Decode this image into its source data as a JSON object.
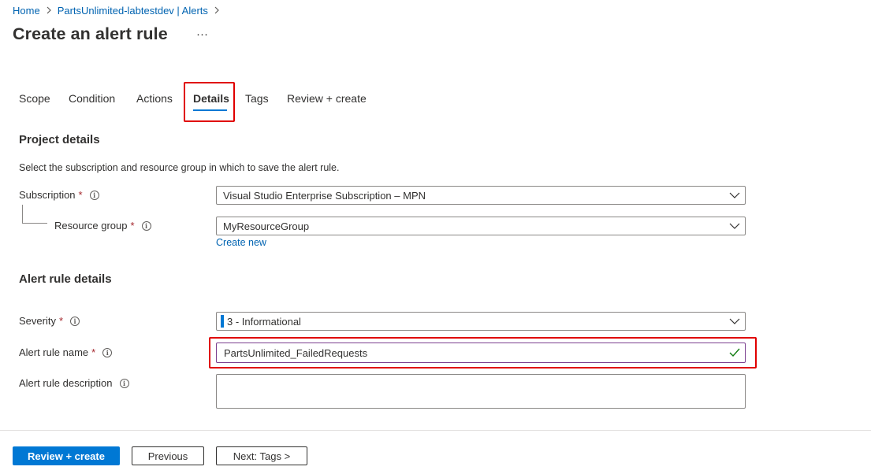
{
  "breadcrumb": {
    "items": [
      "Home",
      "PartsUnlimited-labtestdev | Alerts"
    ]
  },
  "page": {
    "title": "Create an alert rule",
    "more": "···"
  },
  "tabs": [
    "Scope",
    "Condition",
    "Actions",
    "Details",
    "Tags",
    "Review + create"
  ],
  "active_tab": "Details",
  "project_details": {
    "title": "Project details",
    "description": "Select the subscription and resource group in which to save the alert rule.",
    "subscription_label": "Subscription",
    "subscription_value": "Visual Studio Enterprise Subscription – MPN",
    "resource_group_label": "Resource group",
    "resource_group_value": "MyResourceGroup",
    "create_new": "Create new"
  },
  "alert_rule_details": {
    "title": "Alert rule details",
    "severity_label": "Severity",
    "severity_value": "3 - Informational",
    "name_label": "Alert rule name",
    "name_value": "PartsUnlimited_FailedRequests",
    "description_label": "Alert rule description",
    "description_value": ""
  },
  "required_marker": "*",
  "info_glyph": "i",
  "footer": {
    "review_create": "Review + create",
    "previous": "Previous",
    "next": "Next: Tags >"
  },
  "colors": {
    "accent": "#0078d4",
    "link": "#0063b1",
    "required": "#a4262c",
    "highlight": "#e00000",
    "valid_check": "#107c10"
  },
  "icons": [
    "chevron-right-icon",
    "chevron-down-icon",
    "info-icon",
    "checkmark-icon"
  ]
}
